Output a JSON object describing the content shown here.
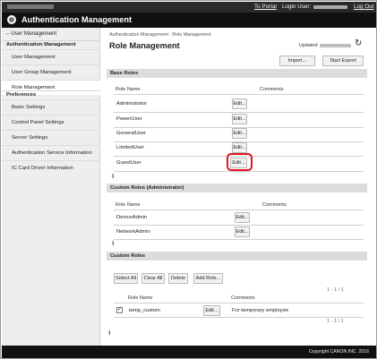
{
  "topbar": {
    "portal_label": "To Portal",
    "login_user_label": "Login User:",
    "logout_label": "Log Out"
  },
  "header": {
    "app_title": "Authentication Management"
  },
  "sidebar": {
    "back_label": "←User Management",
    "section1": "Authentication Management",
    "items1": [
      {
        "label": "User Management"
      },
      {
        "label": "User Group Management"
      },
      {
        "label": "Role Management",
        "active": true
      }
    ],
    "section2": "Preferences",
    "items2": [
      {
        "label": "Basic Settings"
      },
      {
        "label": "Control Panel Settings"
      },
      {
        "label": "Server Settings"
      },
      {
        "label": "Authentication Service Information"
      },
      {
        "label": "IC Card Driver Information"
      }
    ]
  },
  "main": {
    "breadcrumb": "Authentication Management : Role Management",
    "title": "Role Management",
    "updated_label": "Updated:",
    "import_label": "Import...",
    "export_label": "Start Export",
    "base_roles": {
      "heading": "Base Roles",
      "col_name": "Role Name",
      "col_comments": "Comments",
      "rows": [
        "Administrator",
        "PowerUser",
        "GeneralUser",
        "LimitedUser",
        "GuestUser"
      ],
      "edit_label": "Edit..."
    },
    "custom_admin": {
      "heading": "Custom Roles (Administrator)",
      "col_name": "Role Name",
      "col_comments": "Comments",
      "rows": [
        "DeviceAdmin",
        "NetworkAdmin"
      ],
      "edit_label": "Edit..."
    },
    "custom_roles": {
      "heading": "Custom Roles",
      "select_all": "Select All",
      "clear_all": "Clear All",
      "delete": "Delete",
      "add_role": "Add Role...",
      "pager": "1 - 1 / 1",
      "col_name": "Role Name",
      "col_comments": "Comments",
      "rows": [
        {
          "name": "temp_custom",
          "comment": "For temporary employee",
          "checked": true
        }
      ],
      "edit_label": "Edit..."
    }
  },
  "footer": {
    "copyright": "Copyright CANON INC. 2016"
  },
  "colors": {
    "header_bg": "#101010",
    "highlight": "#e0141e",
    "section_bg": "#dcdcdc"
  }
}
